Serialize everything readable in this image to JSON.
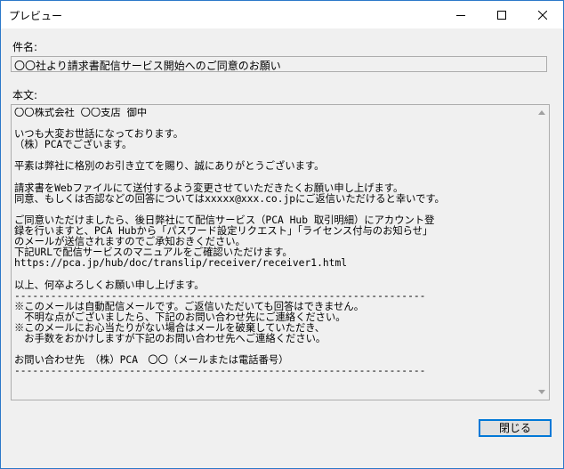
{
  "window": {
    "title": "プレビュー"
  },
  "subject": {
    "label": "件名:",
    "value": "〇〇社より請求書配信サービス開始へのご同意のお願い"
  },
  "body": {
    "label": "本文:",
    "text": "〇〇株式会社 〇〇支店 御中\n\nいつも大変お世話になっております。\n（株）PCAでございます。\n\n平素は弊社に格別のお引き立てを賜り、誠にありがとうございます。\n\n請求書をWebファイルにて送付するよう変更させていただきたくお願い申し上げます。\n同意、もしくは否認などの回答についてはxxxxx@xxx.co.jpにご返信いただけると幸いです。\n\nご同意いただけましたら、後日弊社にて配信サービス（PCA Hub 取引明細）にアカウント登\n録を行いますと、PCA Hubから「パスワード設定リクエスト」「ライセンス付与のお知らせ」\nのメールが送信されますのでご承知おきください。\n下記URLで配信サービスのマニュアルをご確認いただけます。\nhttps://pca.jp/hub/doc/translip/receiver/receiver1.html\n\n以上、何卒よろしくお願い申し上げます。\n--------------------------------------------------------------------\n※このメールは自動配信メールです。ご返信いただいても回答はできません。\n　不明な点がございましたら、下記のお問い合わせ先にご連絡ください。\n※このメールにお心当たりがない場合はメールを破棄していただき、\n　お手数をおかけしますが下記のお問い合わせ先へご連絡ください。\n\nお問い合わせ先　（株）PCA　〇〇（メールまたは電話番号）\n--------------------------------------------------------------------"
  },
  "buttons": {
    "close_label": "閉じる"
  },
  "icons": {
    "minimize": "minimize-icon",
    "maximize": "maximize-icon",
    "close": "close-icon",
    "scroll_up": "chevron-up-icon",
    "scroll_down": "chevron-down-icon"
  }
}
